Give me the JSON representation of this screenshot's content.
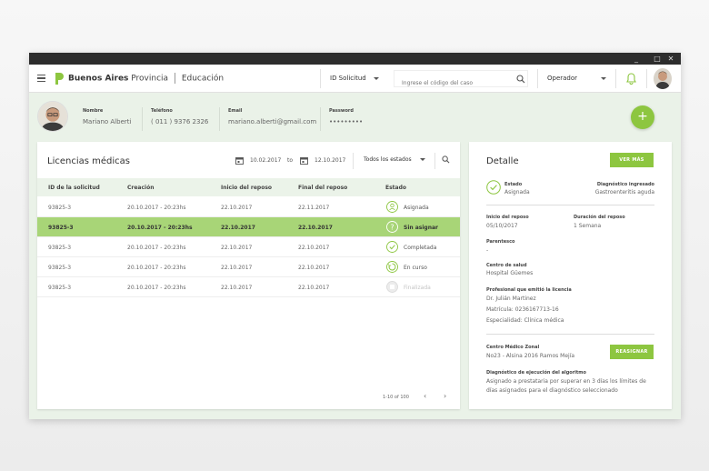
{
  "window": {
    "controls": [
      "_",
      "□",
      "✕"
    ]
  },
  "topbar": {
    "brand_bold": "Buenos Aires",
    "brand_light": "Provincia",
    "brand_section": "Educación",
    "id_select": "ID Solicitud",
    "search_placeholder": "Ingrese el código del caso",
    "role_select": "Operador"
  },
  "user": {
    "nombre_label": "Nombre",
    "nombre": "Mariano Alberti",
    "telefono_label": "Teléfono",
    "telefono": "( 011 )   9376 2326",
    "email_label": "Email",
    "email": "mariano.alberti@gmail.com",
    "password_label": "Password",
    "password": "•••••••••"
  },
  "fab_label": "+",
  "list": {
    "title": "Licencias médicas",
    "date_from": "10.02.2017",
    "date_to_label": "to",
    "date_to": "12.10.2017",
    "status_filter": "Todos los estados",
    "columns": [
      "ID de la solicitud",
      "Creación",
      "Inicio del reposo",
      "Final del reposo",
      "Estado"
    ],
    "rows": [
      {
        "id": "93825-3",
        "creacion": "20.10.2017 - 20:23hs",
        "inicio": "22.10.2017",
        "final": "22.11.2017",
        "estado": "Asignada",
        "icon": "person-icon"
      },
      {
        "id": "93825-3",
        "creacion": "20.10.2017 - 20:23hs",
        "inicio": "22.10.2017",
        "final": "22.10.2017",
        "estado": "Sin asignar",
        "icon": "question-icon"
      },
      {
        "id": "93825-3",
        "creacion": "20.10.2017 - 20:23hs",
        "inicio": "22.10.2017",
        "final": "22.10.2017",
        "estado": "Completada",
        "icon": "check-icon"
      },
      {
        "id": "93825-3",
        "creacion": "20.10.2017 - 20:23hs",
        "inicio": "22.10.2017",
        "final": "22.10.2017",
        "estado": "En curso",
        "icon": "progress-icon"
      },
      {
        "id": "93825-3",
        "creacion": "20.10.2017 - 20:23hs",
        "inicio": "22.10.2017",
        "final": "22.10.2017",
        "estado": "Finalizada",
        "icon": "finished-icon"
      }
    ],
    "pagination": "1-10 of 100",
    "prev": "‹",
    "next": "›"
  },
  "detail": {
    "title": "Detalle",
    "ver_mas": "VER MÁS",
    "estado_label": "Estado",
    "estado": "Asignada",
    "diag_label": "Diagnóstico ingresado",
    "diag": "Gastroenteritis aguda",
    "inicio_label": "Inicio del reposo",
    "inicio": "05/10/2017",
    "duracion_label": "Duración del reposo",
    "duracion": "1 Semana",
    "parentesco_label": "Parentesco",
    "parentesco": "-",
    "centro_label": "Centro de salud",
    "centro": "Hospital Güemes",
    "prof_label": "Profesional que emitió la licencia",
    "prof_name": "Dr. Julián Martinez",
    "prof_mat": "Matrícula: 0236167713-16",
    "prof_esp": "Especialidad: Clínica médica",
    "zonal_label": "Centro Médico Zonal",
    "zonal": "No23 - Alsina 2016 Ramos Mejía",
    "reasignar": "REASIGNAR",
    "algo_label": "Diagnóstico de ejecución del algoritmo",
    "algo_1": "Asignado a prestataria por superar en 3 días los límites de",
    "algo_2": "días asignados para el diagnóstico seleccionado"
  },
  "colors": {
    "accent": "#8dc640",
    "selected_row": "#a8d577",
    "background": "#eaf2e8"
  }
}
